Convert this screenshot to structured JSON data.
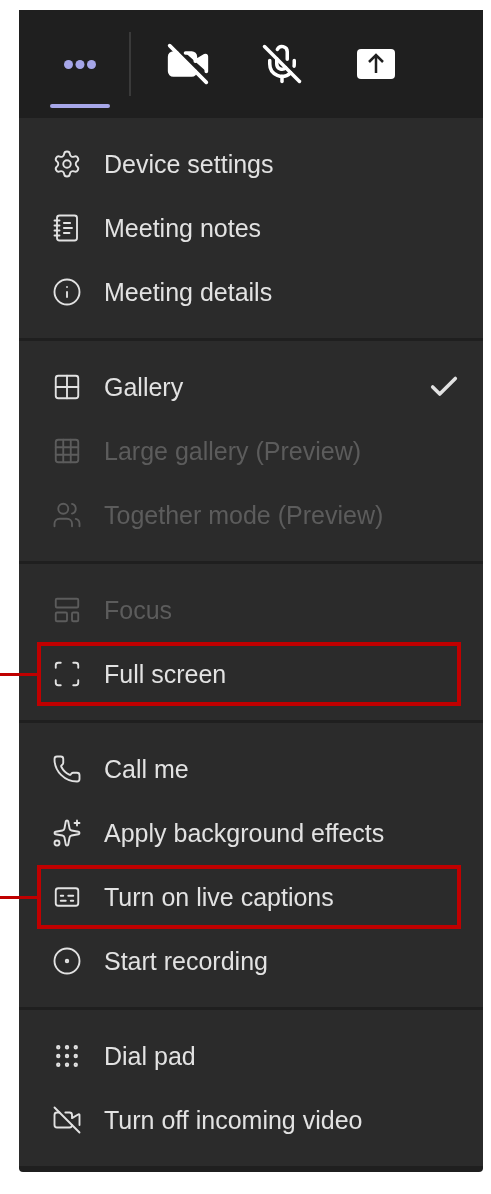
{
  "toolbar": {
    "buttons": [
      {
        "kind": "more",
        "selected": true
      },
      {
        "kind": "camera-off",
        "selected": false
      },
      {
        "kind": "mic-off",
        "selected": false
      },
      {
        "kind": "share",
        "selected": false
      }
    ]
  },
  "menu": {
    "sections": [
      {
        "items": [
          {
            "label": "Device settings",
            "disabled": false,
            "checked": false,
            "highlighted": false
          },
          {
            "label": "Meeting notes",
            "disabled": false,
            "checked": false,
            "highlighted": false
          },
          {
            "label": "Meeting details",
            "disabled": false,
            "checked": false,
            "highlighted": false
          }
        ]
      },
      {
        "items": [
          {
            "label": "Gallery",
            "disabled": false,
            "checked": true,
            "highlighted": false
          },
          {
            "label": "Large gallery (Preview)",
            "disabled": true,
            "checked": false,
            "highlighted": false
          },
          {
            "label": "Together mode (Preview)",
            "disabled": true,
            "checked": false,
            "highlighted": false
          }
        ]
      },
      {
        "items": [
          {
            "label": "Focus",
            "disabled": true,
            "checked": false,
            "highlighted": false
          },
          {
            "label": "Full screen",
            "disabled": false,
            "checked": false,
            "highlighted": true
          }
        ]
      },
      {
        "items": [
          {
            "label": "Call me",
            "disabled": false,
            "checked": false,
            "highlighted": false
          },
          {
            "label": "Apply background effects",
            "disabled": false,
            "checked": false,
            "highlighted": false
          },
          {
            "label": "Turn on live captions",
            "disabled": false,
            "checked": false,
            "highlighted": true
          },
          {
            "label": "Start recording",
            "disabled": false,
            "checked": false,
            "highlighted": false
          }
        ]
      },
      {
        "items": [
          {
            "label": "Dial pad",
            "disabled": false,
            "checked": false,
            "highlighted": false
          },
          {
            "label": "Turn off incoming video",
            "disabled": false,
            "checked": false,
            "highlighted": false
          }
        ]
      }
    ]
  }
}
